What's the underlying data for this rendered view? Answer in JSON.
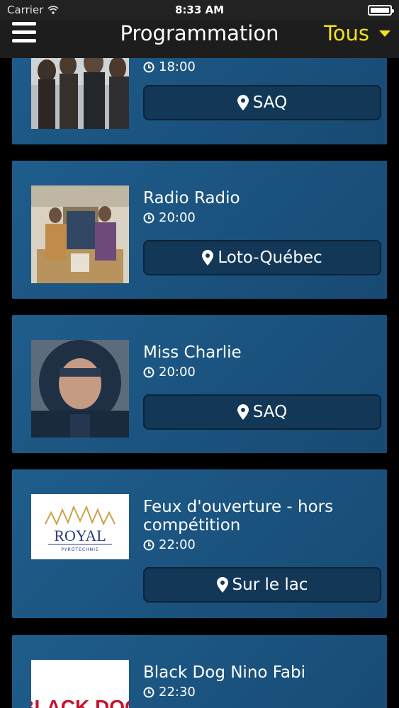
{
  "status": {
    "carrier": "Carrier",
    "time": "8:33 AM"
  },
  "header": {
    "title": "Programmation",
    "filter_label": "Tous"
  },
  "events": [
    {
      "title": "",
      "time": "18:00",
      "venue": "SAQ",
      "image": "band-photo"
    },
    {
      "title": "Radio Radio",
      "time": "20:00",
      "venue": "Loto-Québec",
      "image": "duo-photo"
    },
    {
      "title": "Miss Charlie",
      "time": "20:00",
      "venue": "SAQ",
      "image": "portrait-photo"
    },
    {
      "title": "Feux d'ouverture - hors compétition",
      "time": "22:00",
      "venue": "Sur le lac",
      "image": "royal-logo",
      "logo_text": "ROYAL",
      "logo_subtext": "PYROTECHNIE"
    },
    {
      "title": "Black Dog Nino Fabi",
      "time": "22:30",
      "venue": "",
      "image": "black-dog-poster",
      "logo_text": "BLACK DOG"
    }
  ],
  "colors": {
    "accent": "#f2e21a",
    "card": "#1f5d8c",
    "background": "#000000"
  }
}
